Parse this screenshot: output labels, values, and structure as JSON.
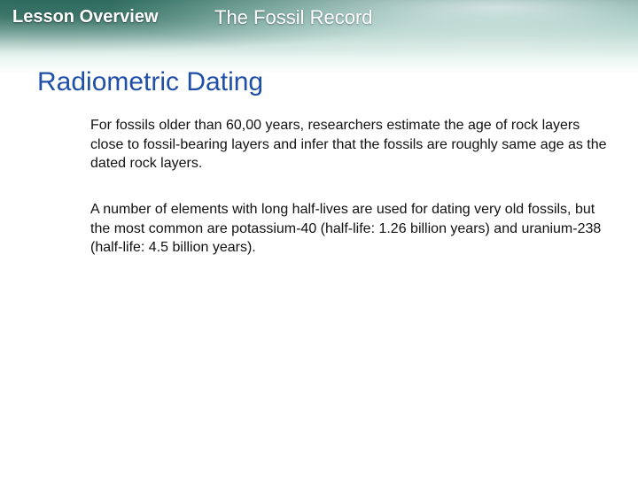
{
  "header": {
    "section_label": "Lesson Overview",
    "lesson_title": "The Fossil Record"
  },
  "slide": {
    "heading": "Radiometric Dating",
    "paragraphs": [
      "For fossils older than 60,00 years, researchers estimate the age of rock layers close to fossil-bearing layers and infer that the fossils are roughly same age as the dated rock layers.",
      "A number of elements with long half-lives are used for dating very old fossils, but the most common are potassium-40 (half-life: 1.26 billion years) and uranium-238 (half-life: 4.5 billion years)."
    ]
  },
  "colors": {
    "header_dark": "#3a7d6f",
    "heading": "#1f4fa8",
    "body_text": "#111111"
  }
}
